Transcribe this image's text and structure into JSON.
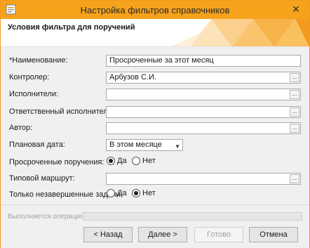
{
  "window": {
    "title": "Настройка фильтров справочников",
    "close_glyph": "✕",
    "accent": "#f7a21b"
  },
  "header": {
    "heading": "Условия фильтра для поручений"
  },
  "form": {
    "name": {
      "label": "*Наименование:",
      "value": "Просроченные за этот месяц"
    },
    "controller": {
      "label": "Контролер:",
      "value": "Арбузов С.И."
    },
    "executors": {
      "label": "Исполнители:",
      "value": ""
    },
    "responsible": {
      "label": "Ответственный исполнитель:",
      "value": ""
    },
    "author": {
      "label": "Автор:",
      "value": ""
    },
    "planned_date": {
      "label": "Плановая дата:",
      "value": "В этом месяце"
    },
    "overdue": {
      "label": "Просроченные поручения:",
      "yes": "Да",
      "no": "Нет",
      "selected": "yes"
    },
    "route": {
      "label": "Типовой маршрут:",
      "value": ""
    },
    "unfinished": {
      "label": "Только незавершенные задачи:",
      "yes": "Да",
      "no": "Нет",
      "selected": "no"
    },
    "ellipsis": "..."
  },
  "footer": {
    "operation_label": "Выполняется операция",
    "back": "< Назад",
    "next": "Далее >",
    "finish": "Готово",
    "cancel": "Отмена"
  }
}
